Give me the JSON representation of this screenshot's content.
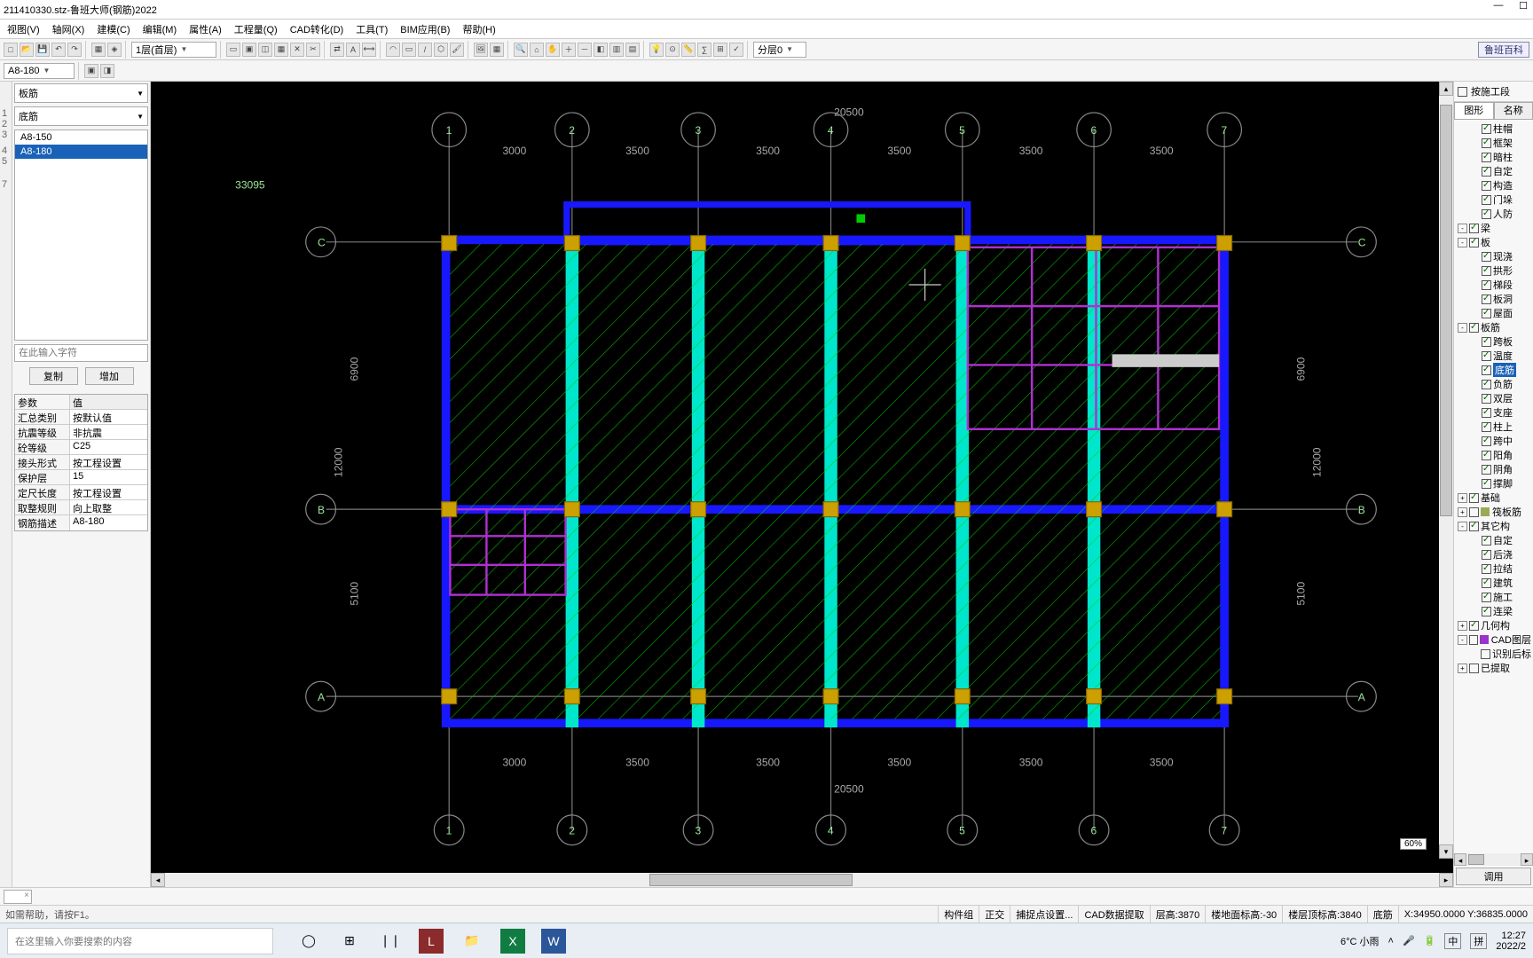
{
  "window": {
    "title": "211410330.stz-鲁班大师(钢筋)2022",
    "min": "—",
    "max": "☐"
  },
  "menu": [
    "视图(V)",
    "轴网(X)",
    "建模(C)",
    "编辑(M)",
    "属性(A)",
    "工程量(Q)",
    "CAD转化(D)",
    "工具(T)",
    "BIM应用(B)",
    "帮助(H)"
  ],
  "toolbar": {
    "combo1": "A8-180",
    "floor": "1层(首层)",
    "layer": "分层0",
    "zoom": "60%",
    "encyc": "鲁班百科"
  },
  "left": {
    "type1": "板筋",
    "type2": "底筋",
    "items": [
      {
        "label": "A8-150",
        "sel": false
      },
      {
        "label": "A8-180",
        "sel": true
      }
    ],
    "search_ph": "在此输入字符",
    "copy_btn": "复制",
    "add_btn": "增加",
    "prop_head_k": "参数",
    "prop_head_v": "值",
    "props": [
      {
        "k": "汇总类别",
        "v": "按默认值"
      },
      {
        "k": "抗震等级",
        "v": "非抗震"
      },
      {
        "k": "砼等级",
        "v": "C25"
      },
      {
        "k": "接头形式",
        "v": "按工程设置"
      },
      {
        "k": "保护层(mm)",
        "v": "15"
      },
      {
        "k": "定尺长度",
        "v": "按工程设置"
      },
      {
        "k": "取整规则",
        "v": "向上取整"
      },
      {
        "k": "钢筋描述",
        "v": "A8-180"
      }
    ]
  },
  "canvas": {
    "ref": "33095",
    "grid_cols": [
      "1",
      "2",
      "3",
      "4",
      "5",
      "6",
      "7"
    ],
    "grid_rows": [
      "A",
      "B",
      "C"
    ],
    "dims_top": [
      "3000",
      "3500",
      "3500",
      "3500",
      "3500",
      "3500"
    ],
    "dims_bot": [
      "3000",
      "3500",
      "3500",
      "3500",
      "3500",
      "3500"
    ],
    "dim_total_top": "20500",
    "dim_total_bot": "20500",
    "dim_left": [
      "5100",
      "6900"
    ],
    "dim_right": [
      "5100",
      "6900"
    ],
    "dim_side_total": "12000"
  },
  "right": {
    "filter_chk": "按施工段",
    "tab1": "图形",
    "tab2": "名称",
    "btn": "调用",
    "tree": [
      {
        "ind": 1,
        "chk": true,
        "lbl": "柱帽"
      },
      {
        "ind": 1,
        "chk": true,
        "lbl": "框架"
      },
      {
        "ind": 1,
        "chk": true,
        "lbl": "暗柱"
      },
      {
        "ind": 1,
        "chk": true,
        "lbl": "自定"
      },
      {
        "ind": 1,
        "chk": true,
        "lbl": "构造"
      },
      {
        "ind": 1,
        "chk": true,
        "lbl": "门垛"
      },
      {
        "ind": 1,
        "chk": true,
        "lbl": "人防"
      },
      {
        "ind": 0,
        "exp": "-",
        "chk": true,
        "lbl": "梁"
      },
      {
        "ind": 0,
        "exp": "-",
        "chk": true,
        "lbl": "板"
      },
      {
        "ind": 1,
        "chk": true,
        "lbl": "现浇"
      },
      {
        "ind": 1,
        "chk": true,
        "lbl": "拱形"
      },
      {
        "ind": 1,
        "chk": true,
        "lbl": "梯段"
      },
      {
        "ind": 1,
        "chk": true,
        "lbl": "板洞"
      },
      {
        "ind": 1,
        "chk": true,
        "lbl": "屋面"
      },
      {
        "ind": 0,
        "exp": "-",
        "chk": true,
        "lbl": "板筋"
      },
      {
        "ind": 1,
        "chk": true,
        "lbl": "跨板"
      },
      {
        "ind": 1,
        "chk": true,
        "lbl": "温度"
      },
      {
        "ind": 1,
        "chk": true,
        "lbl": "底筋",
        "sel": true
      },
      {
        "ind": 1,
        "chk": true,
        "lbl": "负筋"
      },
      {
        "ind": 1,
        "chk": true,
        "lbl": "双层"
      },
      {
        "ind": 1,
        "chk": true,
        "lbl": "支座"
      },
      {
        "ind": 1,
        "chk": true,
        "lbl": "柱上"
      },
      {
        "ind": 1,
        "chk": true,
        "lbl": "跨中"
      },
      {
        "ind": 1,
        "chk": true,
        "lbl": "阳角"
      },
      {
        "ind": 1,
        "chk": true,
        "lbl": "阴角"
      },
      {
        "ind": 1,
        "chk": true,
        "lbl": "撑脚"
      },
      {
        "ind": 0,
        "exp": "+",
        "chk": true,
        "lbl": "基础"
      },
      {
        "ind": 0,
        "exp": "+",
        "chk": false,
        "sq": "#9a5",
        "lbl": "筏板筋"
      },
      {
        "ind": 0,
        "exp": "-",
        "chk": true,
        "lbl": "其它构"
      },
      {
        "ind": 1,
        "chk": true,
        "lbl": "自定"
      },
      {
        "ind": 1,
        "chk": true,
        "lbl": "后浇"
      },
      {
        "ind": 1,
        "chk": true,
        "lbl": "拉结"
      },
      {
        "ind": 1,
        "chk": true,
        "lbl": "建筑"
      },
      {
        "ind": 1,
        "chk": true,
        "lbl": "施工"
      },
      {
        "ind": 1,
        "chk": true,
        "lbl": "连梁"
      },
      {
        "ind": 0,
        "exp": "+",
        "chk": true,
        "lbl": "几何构"
      },
      {
        "ind": 0,
        "exp": "-",
        "chk": false,
        "sq": "#93c",
        "lbl": "CAD图层"
      },
      {
        "ind": 1,
        "chk": false,
        "lbl": "识别后标"
      },
      {
        "ind": 0,
        "exp": "+",
        "chk": false,
        "lbl": "已提取"
      }
    ]
  },
  "status": {
    "hint": "如需帮助，请按F1。",
    "grp": "构件组",
    "ortho": "正交",
    "snap": "捕捉点设置...",
    "cad": "CAD数据提取",
    "floor_h": "层高:3870",
    "elev1": "楼地面标高:-30",
    "elev2": "楼层顶标高:3840",
    "mode": "底筋",
    "coord": "X:34950.0000 Y:36835.0000"
  },
  "taskbar": {
    "search_ph": "在这里输入你要搜索的内容",
    "weather": "6°C 小雨",
    "ime1": "中",
    "ime2": "拼",
    "time": "12:27",
    "date": "2022/2"
  }
}
